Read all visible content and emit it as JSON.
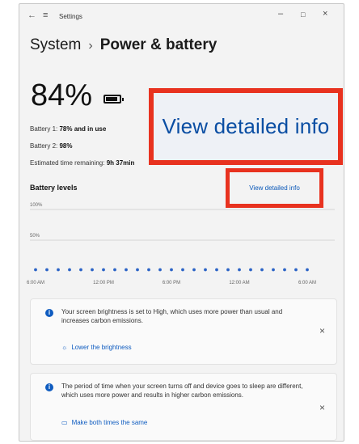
{
  "titlebar": {
    "back_glyph": "←",
    "menu_glyph": "≡",
    "title": "Settings",
    "minimize": "–",
    "maximize": "□",
    "close": "×"
  },
  "breadcrumb": {
    "parent": "System",
    "separator": "›",
    "current": "Power & battery"
  },
  "battery": {
    "percent": "84%",
    "level": 0.84,
    "battery1_label": "Battery 1:",
    "battery1_value": "78% and in use",
    "battery2_label": "Battery 2:",
    "battery2_value": "98%",
    "remaining_label": "Estimated time remaining:",
    "remaining_value": "9h 37min"
  },
  "levels": {
    "title": "Battery levels",
    "detail_link": "View detailed info",
    "detail_link_zoomed": "View detailed info"
  },
  "chart_data": {
    "type": "scatter",
    "title": "Battery levels",
    "y_ticks": [
      "100%",
      "50%"
    ],
    "x_ticks": [
      "6:00 AM",
      "12:00 PM",
      "6:00 PM",
      "12:00 AM",
      "6:00 AM"
    ],
    "ylim": [
      0,
      100
    ],
    "x_hours": [
      0,
      1,
      2,
      3,
      4,
      5,
      6,
      7,
      8,
      9,
      10,
      11,
      12,
      13,
      14,
      15,
      16,
      17,
      18,
      19,
      20,
      21,
      22,
      23,
      24
    ],
    "values": [
      2,
      2,
      2,
      2,
      2,
      2,
      2,
      2,
      2,
      2,
      2,
      2,
      2,
      2,
      2,
      2,
      2,
      2,
      2,
      2,
      2,
      2,
      2,
      2,
      2
    ],
    "point_color": "#2b63c6"
  },
  "cards": [
    {
      "message": "Your screen brightness is set to High, which uses more power than usual and increases carbon emissions.",
      "action": "Lower the brightness",
      "close": "×"
    },
    {
      "message": "The period of time when your screen turns off and device goes to sleep are different, which uses more power and results in higher carbon emissions.",
      "action": "Make both times the same",
      "close": "×"
    }
  ],
  "colors": {
    "accent": "#0f5cc0",
    "highlight": "#e8321f"
  }
}
